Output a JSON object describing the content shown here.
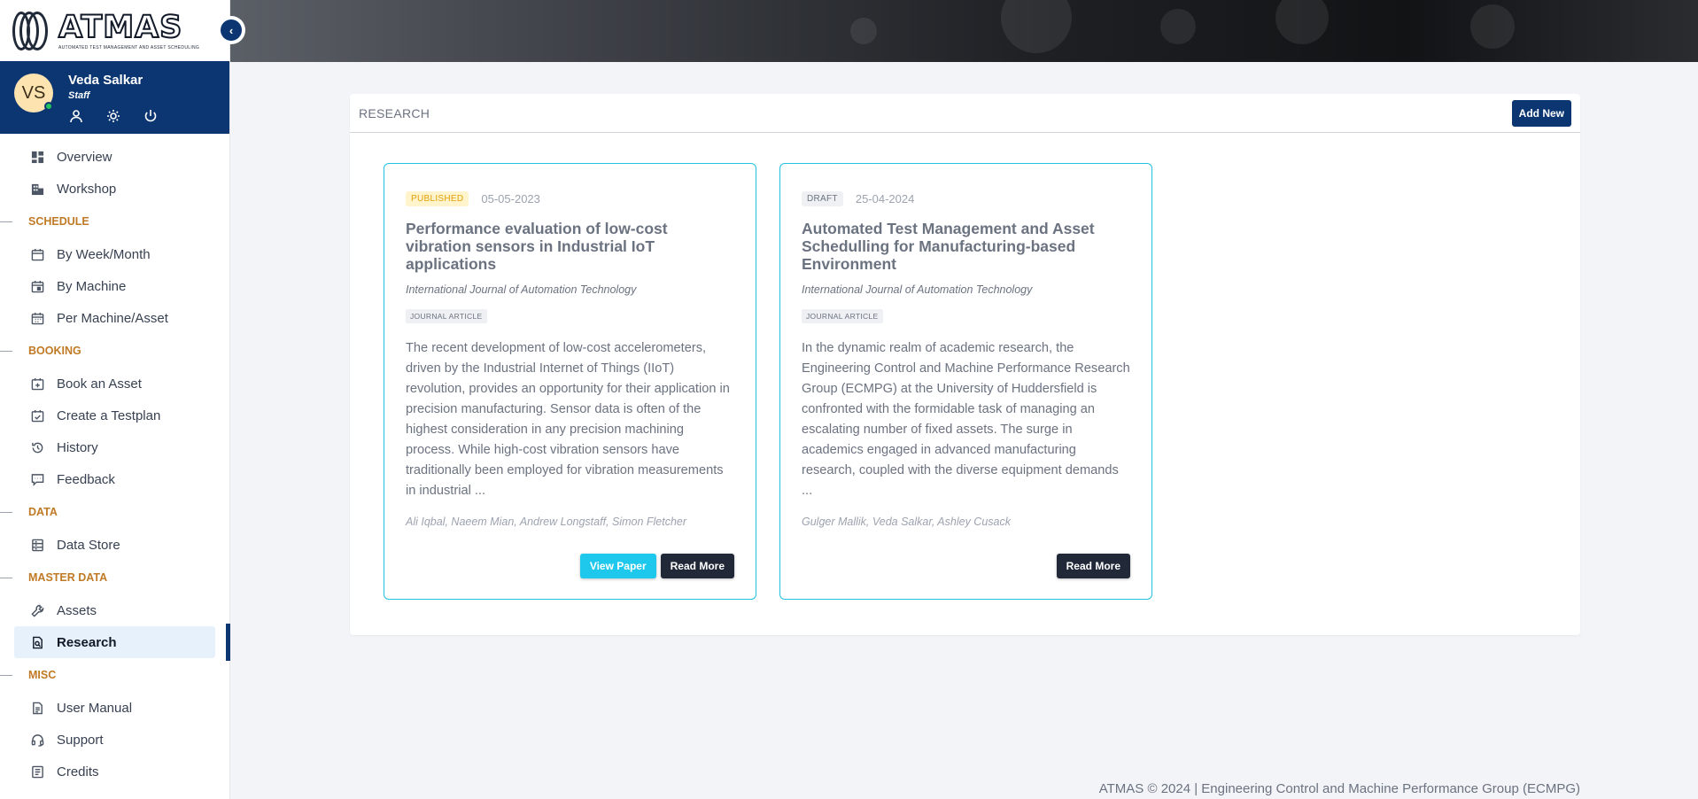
{
  "brand": {
    "name": "ATMAS",
    "tagline": "AUTOMATED TEST MANAGEMENT AND ASSET SCHEDULING"
  },
  "user": {
    "initials": "VS",
    "name": "Veda Salkar",
    "role": "Staff"
  },
  "nav": {
    "overview": "Overview",
    "workshop": "Workshop",
    "schedule_section": "SCHEDULE",
    "by_week_month": "By Week/Month",
    "by_machine": "By Machine",
    "per_machine_asset": "Per Machine/Asset",
    "booking_section": "BOOKING",
    "book_asset": "Book an Asset",
    "create_testplan": "Create a Testplan",
    "history": "History",
    "feedback": "Feedback",
    "data_section": "DATA",
    "data_store": "Data Store",
    "master_section": "MASTER DATA",
    "assets": "Assets",
    "research": "Research",
    "misc_section": "MISC",
    "user_manual": "User Manual",
    "support": "Support",
    "credits": "Credits"
  },
  "page": {
    "title": "RESEARCH",
    "add_new": "Add New"
  },
  "papers": [
    {
      "status": "PUBLISHED",
      "date": "05-05-2023",
      "title": "Performance evaluation of low-cost vibration sensors in Industrial IoT applications",
      "journal": "International Journal of Automation Technology",
      "type": "JOURNAL ARTICLE",
      "abstract": "The recent development of low-cost accelerometers, driven by the Industrial Internet of Things (IIoT) revolution, provides an opportunity for their application in precision manufacturing. Sensor data is often of the highest consideration in any precision machining process. While high-cost vibration sensors have traditionally been employed for vibration measurements in industrial ...",
      "authors": "Ali Iqbal, Naeem Mian, Andrew Longstaff, Simon Fletcher",
      "view_paper": "View Paper",
      "read_more": "Read More"
    },
    {
      "status": "DRAFT",
      "date": "25-04-2024",
      "title": "Automated Test Management and Asset Schedulling for Manufacturing-based Environment",
      "journal": "International Journal of Automation Technology",
      "type": "JOURNAL ARTICLE",
      "abstract": "In the dynamic realm of academic research, the Engineering Control and Machine Performance Research Group (ECMPG) at the University of Huddersfield is confronted with the formidable task of managing an escalating number of fixed assets. The surge in academics engaged in advanced manufacturing research, coupled with the diverse equipment demands ...",
      "authors": "Gulger Mallik, Veda Salkar, Ashley Cusack",
      "read_more": "Read More"
    }
  ],
  "footer": "ATMAS © 2024 | Engineering Control and Machine Performance Group (ECMPG)",
  "colors": {
    "primary": "#0b3672",
    "accent": "#1ec8ec",
    "section": "#c07a25",
    "published": "#e3a008"
  }
}
